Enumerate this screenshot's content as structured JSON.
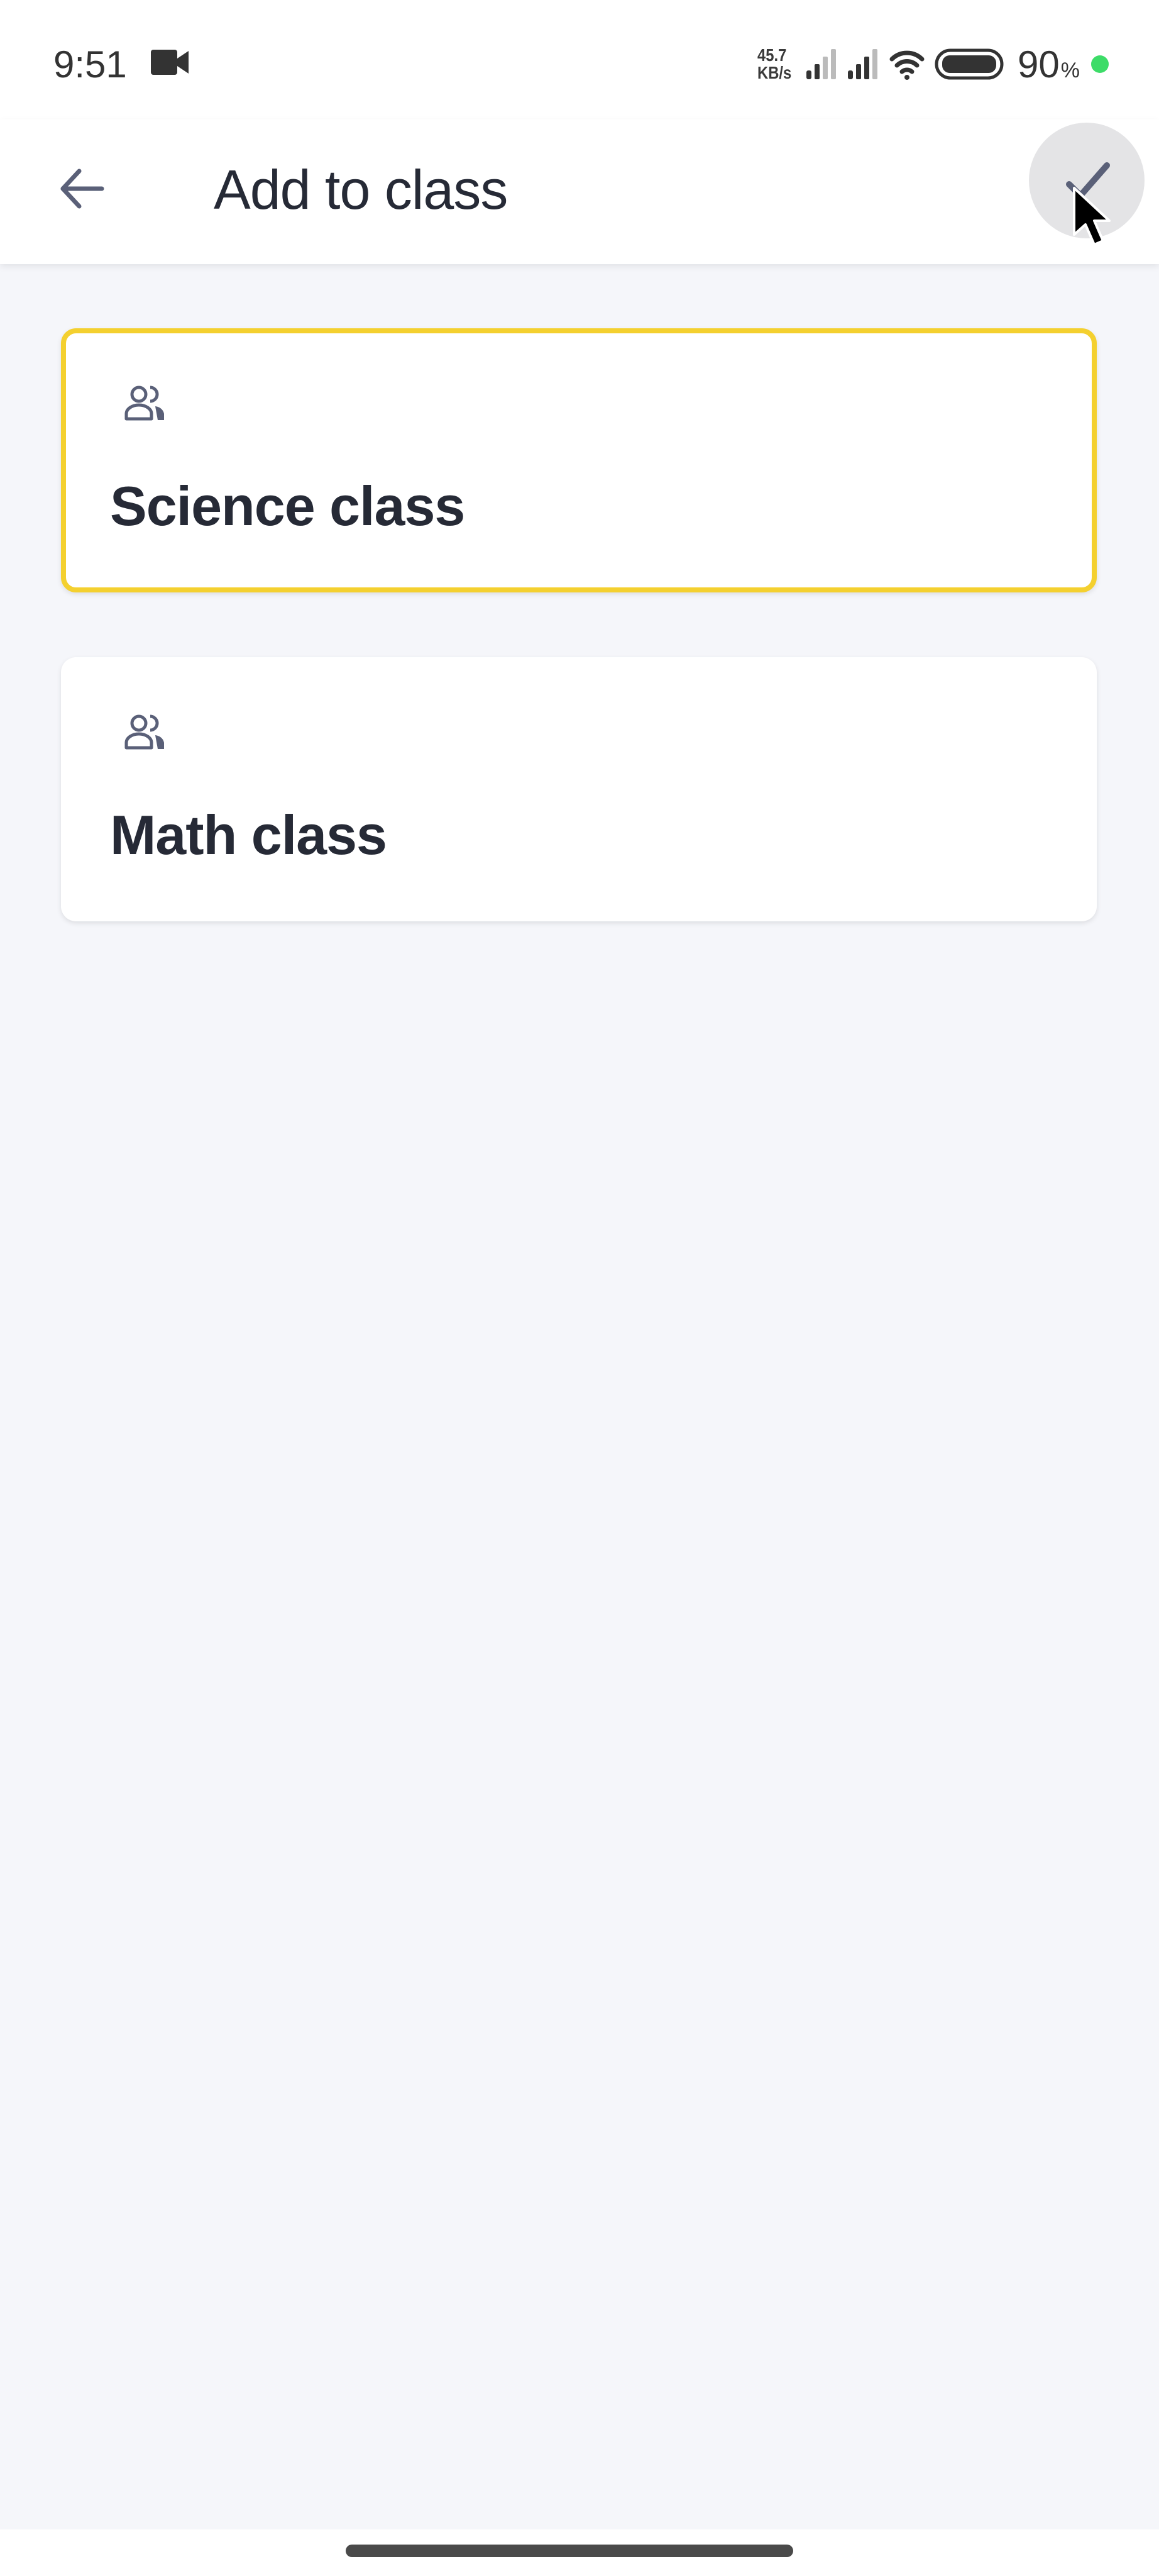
{
  "status_bar": {
    "time": "9:51",
    "recording_icon": "video-camera-icon",
    "net_speed_value": "45.7",
    "net_speed_unit": "KB/s",
    "signal_icons": [
      "signal-bars-icon",
      "signal-bars-icon"
    ],
    "wifi_icon": "wifi-icon",
    "battery_icon": "battery-icon",
    "battery_level": "90",
    "battery_pct_sign": "%",
    "charging_dot_color": "#3DDC68"
  },
  "app_bar": {
    "back_icon": "arrow-left-icon",
    "title": "Add to class",
    "confirm_icon": "check-icon"
  },
  "classes": [
    {
      "name": "Science class",
      "icon": "group-icon",
      "selected": true
    },
    {
      "name": "Math class",
      "icon": "group-icon",
      "selected": false
    }
  ],
  "colors": {
    "selected_border": "#F4D02F",
    "background": "#F5F6FA",
    "text": "#262A36",
    "icon": "#5A6078"
  }
}
